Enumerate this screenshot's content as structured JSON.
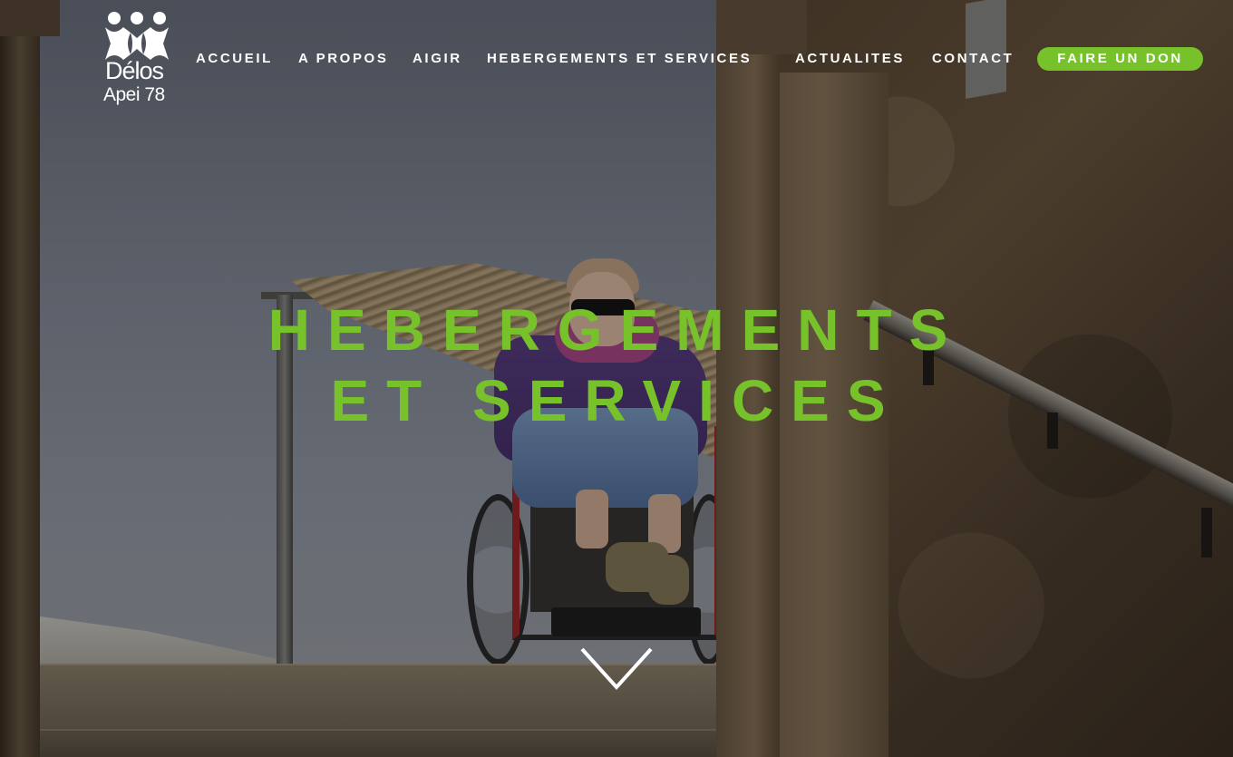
{
  "logo": {
    "name": "Délos",
    "subtitle": "Apei 78"
  },
  "nav": {
    "items": [
      {
        "label": "ACCUEIL"
      },
      {
        "label": "A PROPOS"
      },
      {
        "label": "AIGIR"
      },
      {
        "label": "HEBERGEMENTS ET SERVICES"
      },
      {
        "label": "ACTUALITES"
      },
      {
        "label": "CONTACT"
      }
    ],
    "donate_label": "FAIRE UN DON"
  },
  "hero": {
    "title_line1": "HEBERGEMENTS",
    "title_line2": "ET SERVICES",
    "scroll_icon": "chevron-down-icon"
  },
  "colors": {
    "accent": "#77c22a",
    "nav_text": "#ffffff"
  }
}
